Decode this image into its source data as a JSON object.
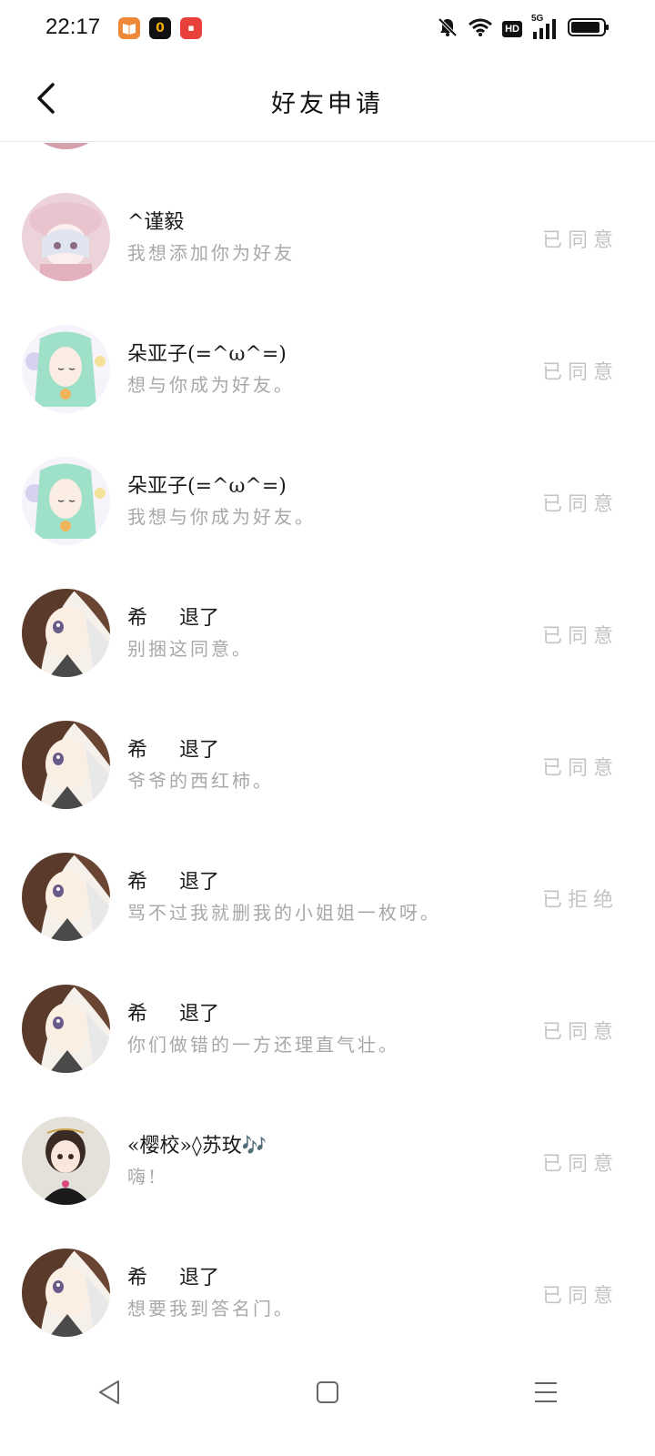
{
  "status_bar": {
    "time": "22:17",
    "app_icons": [
      "books-app-icon",
      "zero-app-icon",
      "red-app-icon"
    ],
    "hd_label": "HD",
    "network_label": "5G",
    "icons": [
      "mute-bell-icon",
      "wifi-icon",
      "signal-icon",
      "battery-icon"
    ]
  },
  "header": {
    "title": "好友申请",
    "back_icon": "chevron-left-icon"
  },
  "requests": [
    {
      "name": "^谨毅",
      "message": "我想添加你为好友",
      "status": "已同意",
      "avatar": "pink-hat-girl"
    },
    {
      "name": "朵亚子(=^ω^=)",
      "message": "想与你成为好友。",
      "status": "已同意",
      "avatar": "green-hair-girl"
    },
    {
      "name": "朵亚子(=^ω^=)",
      "message": "我想与你成为好友。",
      "status": "已同意",
      "avatar": "green-hair-girl"
    },
    {
      "name": "希     退了",
      "message": "别捆这同意。",
      "status": "已同意",
      "avatar": "brown-hair-girl"
    },
    {
      "name": "希     退了",
      "message": "爷爷的西红柿。",
      "status": "已同意",
      "avatar": "brown-hair-girl"
    },
    {
      "name": "希     退了",
      "message": "骂不过我就删我的小姐姐一枚呀。",
      "status": "已拒绝",
      "avatar": "brown-hair-girl"
    },
    {
      "name": "希     退了",
      "message": "你们做错的一方还理直气壮。",
      "status": "已同意",
      "avatar": "brown-hair-girl"
    },
    {
      "name": "«樱校»◊苏玫🎶",
      "message": "嗨!",
      "status": "已同意",
      "avatar": "dark-hair-girl"
    },
    {
      "name": "希     退了",
      "message": "想要我到答名门。",
      "status": "已同意",
      "avatar": "brown-hair-girl"
    }
  ],
  "nav_bar": {
    "icons": [
      "back-triangle-icon",
      "home-square-icon",
      "menu-lines-icon"
    ]
  }
}
